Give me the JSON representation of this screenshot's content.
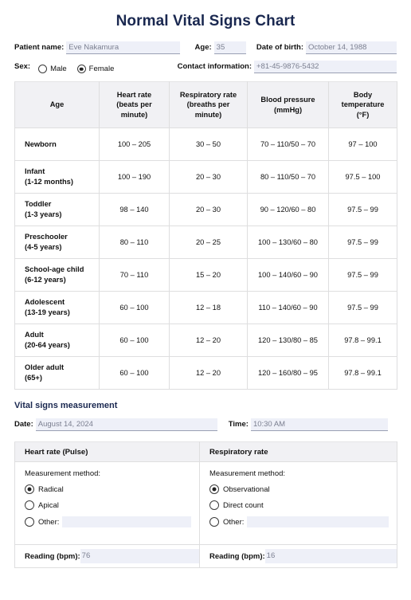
{
  "document": {
    "title": "Normal Vital Signs Chart"
  },
  "patient": {
    "name_label": "Patient name:",
    "name_value": "Eve Nakamura",
    "age_label": "Age:",
    "age_value": "35",
    "dob_label": "Date of birth:",
    "dob_value": "October 14, 1988",
    "sex_label": "Sex:",
    "sex_options": [
      {
        "label": "Male",
        "checked": false
      },
      {
        "label": "Female",
        "checked": true
      }
    ],
    "contact_label": "Contact information:",
    "contact_value": "+81-45-9876-5432"
  },
  "vitals_table": {
    "headers": [
      "Age",
      "Heart rate (beats per minute)",
      "Respiratory rate (breaths per minute)",
      "Blood pressure (mmHg)",
      "Body temperature (°F)"
    ],
    "headers_lines": [
      [
        "Age"
      ],
      [
        "Heart rate",
        "(beats per",
        "minute)"
      ],
      [
        "Respiratory rate",
        "(breaths per",
        "minute)"
      ],
      [
        "Blood pressure",
        "(mmHg)"
      ],
      [
        "Body",
        "temperature",
        "(°F)"
      ]
    ],
    "rows": [
      {
        "age_name": "Newborn",
        "age_sub": "",
        "heart_rate": "100 – 205",
        "respiratory_rate": "30 – 50",
        "blood_pressure": "70 – 110/50 – 70",
        "temperature": "97 – 100"
      },
      {
        "age_name": "Infant",
        "age_sub": "(1-12 months)",
        "heart_rate": "100 – 190",
        "respiratory_rate": "20 – 30",
        "blood_pressure": "80 – 110/50 – 70",
        "temperature": "97.5 – 100"
      },
      {
        "age_name": "Toddler",
        "age_sub": "(1-3 years)",
        "heart_rate": "98 – 140",
        "respiratory_rate": "20 – 30",
        "blood_pressure": "90 – 120/60 – 80",
        "temperature": "97.5 – 99"
      },
      {
        "age_name": "Preschooler",
        "age_sub": "(4-5 years)",
        "heart_rate": "80 – 110",
        "respiratory_rate": "20 – 25",
        "blood_pressure": "100 – 130/60 – 80",
        "temperature": "97.5 – 99"
      },
      {
        "age_name": "School-age child",
        "age_sub": "(6-12 years)",
        "heart_rate": "70 – 110",
        "respiratory_rate": "15 – 20",
        "blood_pressure": "100 – 140/60 – 90",
        "temperature": "97.5 – 99"
      },
      {
        "age_name": "Adolescent",
        "age_sub": "(13-19 years)",
        "heart_rate": "60 – 100",
        "respiratory_rate": "12 – 18",
        "blood_pressure": "110 – 140/60 – 90",
        "temperature": "97.5 – 99"
      },
      {
        "age_name": "Adult",
        "age_sub": "(20-64 years)",
        "heart_rate": "60 – 100",
        "respiratory_rate": "12 – 20",
        "blood_pressure": "120 – 130/80 – 85",
        "temperature": "97.8 – 99.1"
      },
      {
        "age_name": "Older adult",
        "age_sub": "(65+)",
        "heart_rate": "60 – 100",
        "respiratory_rate": "12 – 20",
        "blood_pressure": "120 – 160/80 – 95",
        "temperature": "97.8 – 99.1"
      }
    ]
  },
  "measurement": {
    "section_title": "Vital signs measurement",
    "date_label": "Date:",
    "date_value": "August 14, 2024",
    "time_label": "Time:",
    "time_value": "10:30 AM",
    "heart_rate_panel": {
      "header": "Heart rate (Pulse)",
      "method_label": "Measurement method:",
      "options": [
        {
          "label": "Radical",
          "checked": true,
          "has_field": false
        },
        {
          "label": "Apical",
          "checked": false,
          "has_field": false
        },
        {
          "label": "Other:",
          "checked": false,
          "has_field": true
        }
      ],
      "other_value": "",
      "reading_label": "Reading (bpm):",
      "reading_value": "76"
    },
    "respiratory_rate_panel": {
      "header": "Respiratory rate",
      "method_label": "Measurement method:",
      "options": [
        {
          "label": "Observational",
          "checked": true,
          "has_field": false
        },
        {
          "label": "Direct count",
          "checked": false,
          "has_field": false
        },
        {
          "label": "Other:",
          "checked": false,
          "has_field": true
        }
      ],
      "other_value": "",
      "reading_label": "Reading (bpm):",
      "reading_value": "16"
    }
  },
  "colors": {
    "title": "#1a2850",
    "field_fill": "#eef0f8",
    "field_text": "#7b7f90",
    "table_header_bg": "#f1f1f4",
    "border": "#dededf"
  }
}
